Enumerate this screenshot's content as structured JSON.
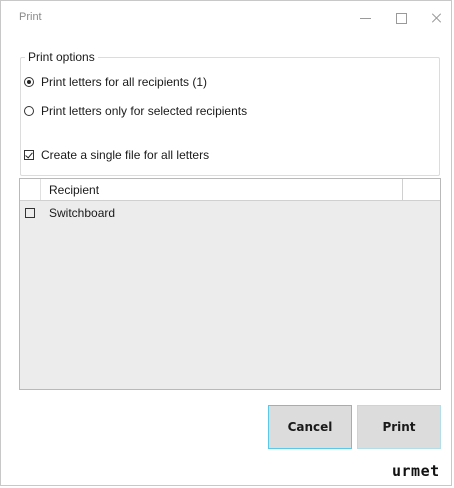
{
  "window": {
    "title": "Print",
    "controls": {
      "minimize": "minimize-icon",
      "maximize": "maximize-icon",
      "close": "close-icon"
    }
  },
  "print_options": {
    "legend": "Print options",
    "radio_all": {
      "label": "Print letters for all recipients (1)",
      "checked": true
    },
    "radio_selected": {
      "label": "Print letters only for selected recipients",
      "checked": false
    },
    "single_file": {
      "label": "Create a single file for all letters",
      "checked": true
    }
  },
  "grid": {
    "header": {
      "recipient": "Recipient"
    },
    "rows": [
      {
        "checked": false,
        "recipient": "Switchboard"
      }
    ]
  },
  "buttons": {
    "cancel": "Cancel",
    "print": "Print"
  },
  "logo": "urmet",
  "colors": {
    "focus_border": "#5bc8e8",
    "button_bg": "#dcdcdc",
    "grid_bg": "#ececec"
  }
}
